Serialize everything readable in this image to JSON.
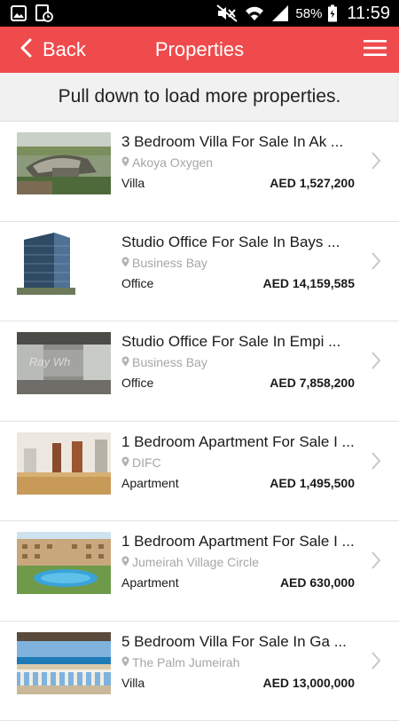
{
  "status_bar": {
    "battery_percent": "58%",
    "time": "11:59",
    "icons": [
      "image-icon",
      "clock-badge-icon",
      "mute-icon",
      "wifi-icon",
      "signal-icon",
      "battery-icon"
    ]
  },
  "header": {
    "back_label": "Back",
    "title": "Properties",
    "background_color": "#ef4b4c"
  },
  "pull_hint": "Pull down to load more properties.",
  "listings": [
    {
      "title": "3 Bedroom Villa For Sale In Ak ...",
      "location": "Akoya Oxygen",
      "type": "Villa",
      "price": "AED 1,527,200"
    },
    {
      "title": "Studio Office For Sale In Bays ...",
      "location": "Business Bay",
      "type": "Office",
      "price": "AED 14,159,585"
    },
    {
      "title": "Studio Office For Sale In Empi ...",
      "location": "Business Bay",
      "type": "Office",
      "price": "AED 7,858,200",
      "watermark": "Ray Wh"
    },
    {
      "title": "1 Bedroom Apartment For Sale I ...",
      "location": "DIFC",
      "type": "Apartment",
      "price": "AED 1,495,500"
    },
    {
      "title": "1 Bedroom Apartment For Sale I ...",
      "location": "Jumeirah Village Circle",
      "type": "Apartment",
      "price": "AED 630,000"
    },
    {
      "title": "5 Bedroom Villa For Sale In Ga ...",
      "location": "The Palm Jumeirah",
      "type": "Villa",
      "price": "AED 13,000,000"
    }
  ]
}
